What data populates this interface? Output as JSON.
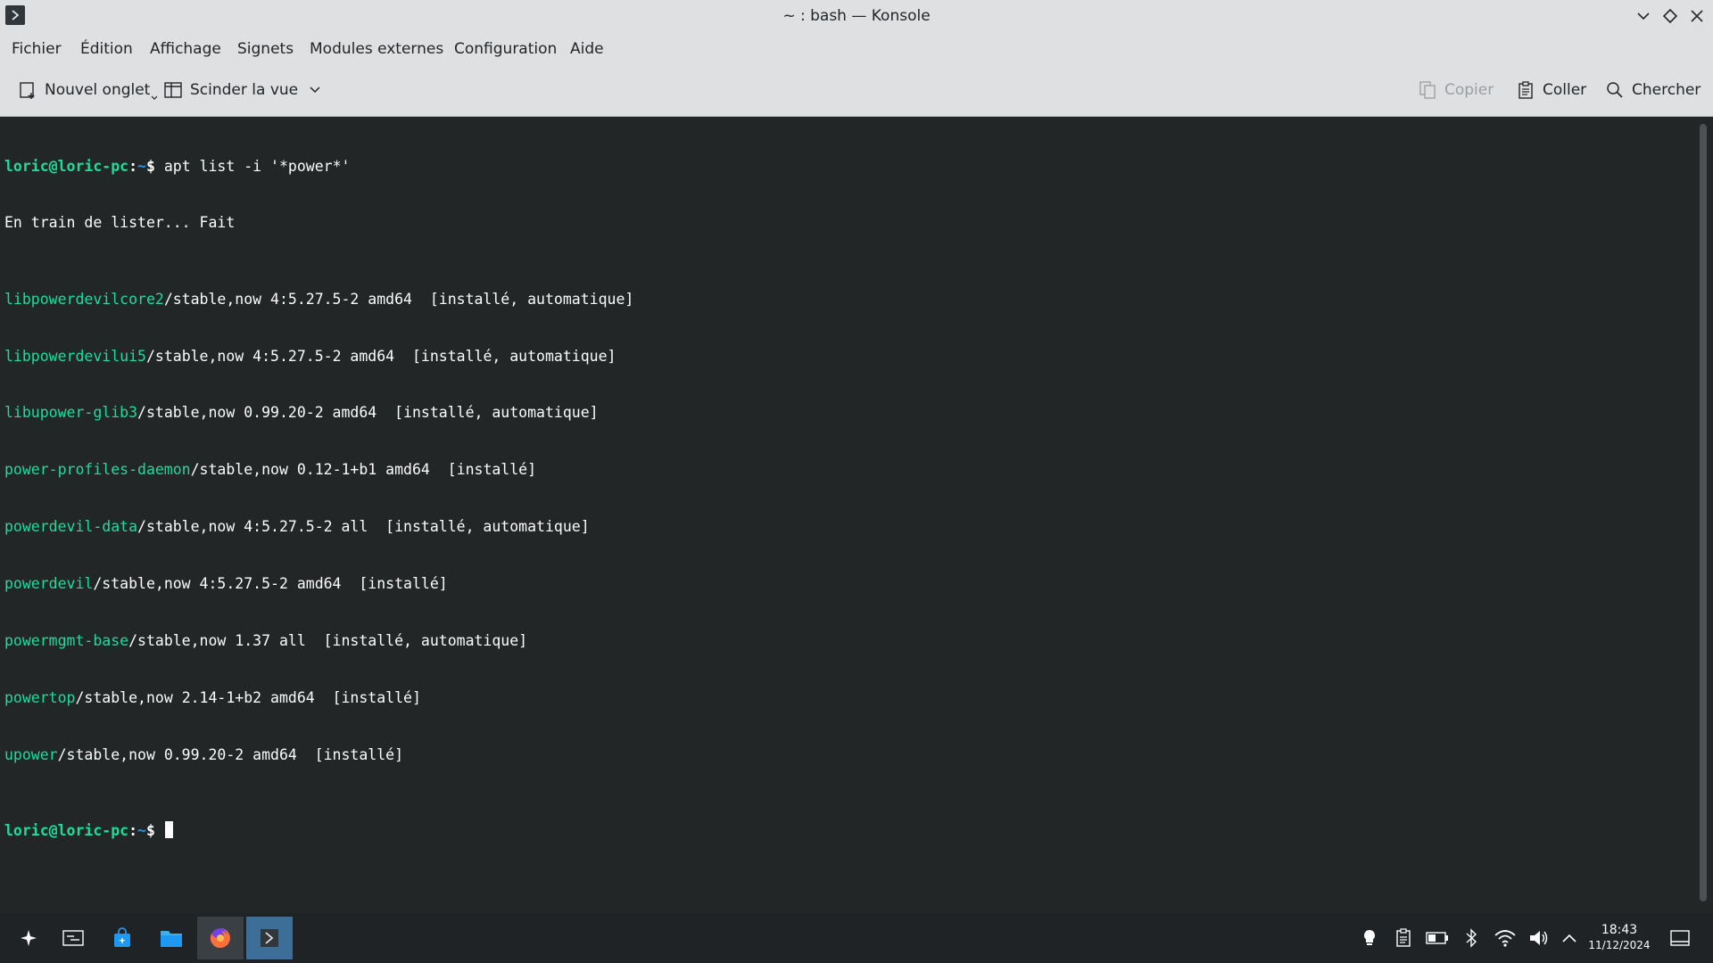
{
  "window": {
    "title": "~ : bash — Konsole"
  },
  "menu": {
    "items": [
      "Fichier",
      "Édition",
      "Affichage",
      "Signets",
      "Modules externes",
      "Configuration",
      "Aide"
    ]
  },
  "toolbar": {
    "new_tab_label": "Nouvel onglet",
    "split_view_label": "Scinder la vue",
    "copy_label": "Copier",
    "paste_label": "Coller",
    "find_label": "Chercher"
  },
  "terminal": {
    "prompt": {
      "user": "loric@loric-pc",
      "separator": ":",
      "path": "~",
      "symbol": "$ "
    },
    "command": "apt list -i '*power*'",
    "status_line": "En train de lister... Fait",
    "packages": [
      {
        "name": "libpowerdevilcore2",
        "rest": "/stable,now 4:5.27.5-2 amd64  [installé, automatique]"
      },
      {
        "name": "libpowerdevilui5",
        "rest": "/stable,now 4:5.27.5-2 amd64  [installé, automatique]"
      },
      {
        "name": "libupower-glib3",
        "rest": "/stable,now 0.99.20-2 amd64  [installé, automatique]"
      },
      {
        "name": "power-profiles-daemon",
        "rest": "/stable,now 0.12-1+b1 amd64  [installé]"
      },
      {
        "name": "powerdevil-data",
        "rest": "/stable,now 4:5.27.5-2 all  [installé, automatique]"
      },
      {
        "name": "powerdevil",
        "rest": "/stable,now 4:5.27.5-2 amd64  [installé]"
      },
      {
        "name": "powermgmt-base",
        "rest": "/stable,now 1.37 all  [installé, automatique]"
      },
      {
        "name": "powertop",
        "rest": "/stable,now 2.14-1+b2 amd64  [installé]"
      },
      {
        "name": "upower",
        "rest": "/stable,now 0.99.20-2 amd64  [installé]"
      }
    ]
  },
  "taskbar": {
    "clock_time": "18:43",
    "clock_date": "11/12/2024"
  },
  "colors": {
    "terminal_bg": "#232627",
    "package_green": "#1cdc9a",
    "path_blue": "#1d99f3",
    "chrome_bg": "#dee0e2",
    "taskbar_bg": "#202326"
  }
}
